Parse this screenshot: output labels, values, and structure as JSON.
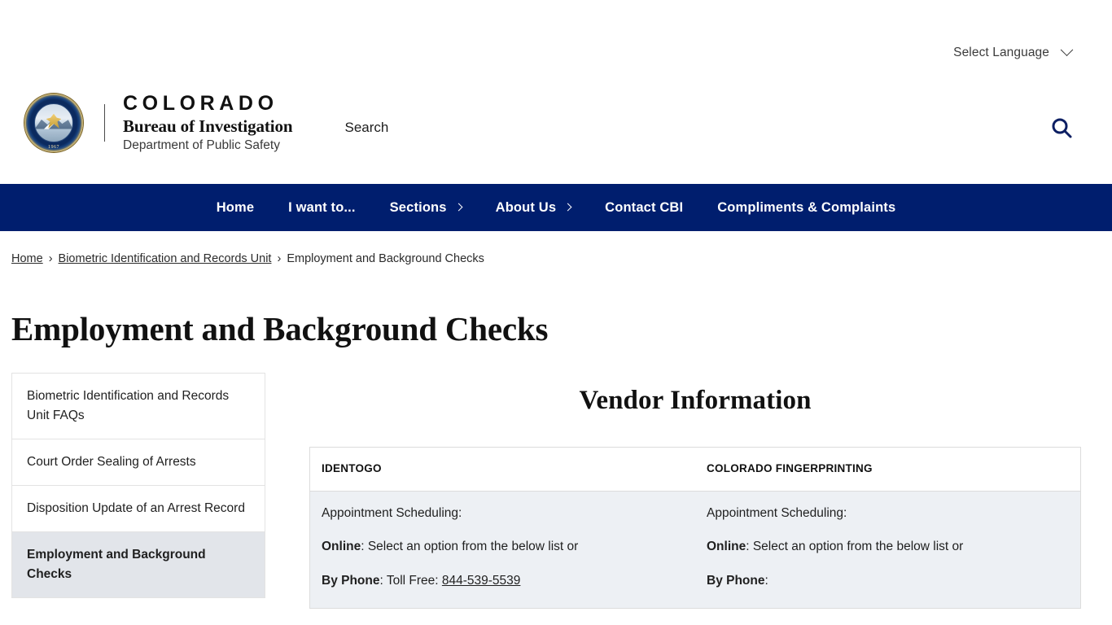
{
  "utility": {
    "language_label": "Select Language",
    "chevron_icon": "chevron-down-icon"
  },
  "brand": {
    "seal_alt": "colorado-bureau-of-investigation-seal",
    "seal_year": "1967",
    "state": "COLORADO",
    "department": "Bureau of Investigation",
    "parent": "Department of Public Safety"
  },
  "search": {
    "placeholder": "Search",
    "value": "",
    "icon": "search-icon"
  },
  "nav": {
    "accent_color": "#001e6e",
    "items": [
      {
        "label": "Home",
        "has_caret": false
      },
      {
        "label": "I want to...",
        "has_caret": false
      },
      {
        "label": "Sections",
        "has_caret": true
      },
      {
        "label": "About Us",
        "has_caret": true
      },
      {
        "label": "Contact CBI",
        "has_caret": false
      },
      {
        "label": "Compliments & Complaints",
        "has_caret": false
      }
    ]
  },
  "breadcrumb": {
    "items": [
      {
        "label": "Home",
        "link": true
      },
      {
        "label": "Biometric Identification and Records Unit",
        "link": true
      },
      {
        "label": "Employment and Background Checks",
        "link": false
      }
    ],
    "separator": "›"
  },
  "page": {
    "title": "Employment and Background Checks"
  },
  "sidebar": {
    "items": [
      {
        "label": "Biometric Identification and Records Unit FAQs",
        "active": false
      },
      {
        "label": "Court Order Sealing of Arrests",
        "active": false
      },
      {
        "label": "Disposition Update of an Arrest Record",
        "active": false
      },
      {
        "label": "Employment and Background Checks",
        "active": true
      }
    ]
  },
  "main": {
    "section_heading": "Vendor Information",
    "table": {
      "headers": [
        "IDENTOGO",
        "COLORADO FINGERPRINTING"
      ],
      "row": {
        "identogo": {
          "line1": "Appointment Scheduling:",
          "line2_label": "Online",
          "line2_text": ": Select an option from the below list or",
          "line3_label": "By Phone",
          "line3_text": ": Toll Free: ",
          "line3_link": "844-539-5539"
        },
        "colorado_fingerprinting": {
          "line1": "Appointment Scheduling:",
          "line2_label": "Online",
          "line2_text": ": Select an option from the below list or",
          "line3_label": "By Phone",
          "line3_text": ":",
          "line3_link": ""
        }
      }
    }
  }
}
